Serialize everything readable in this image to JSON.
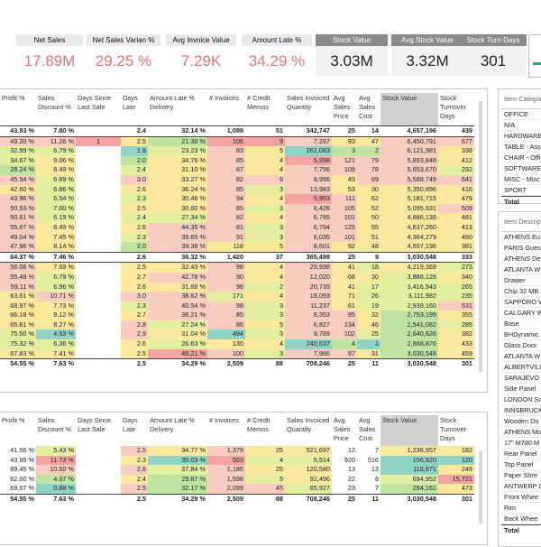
{
  "kpis": [
    {
      "label": "Net Sales",
      "value": "17.89M",
      "dark": false
    },
    {
      "label": "Net Sales Varian %",
      "value": "29.25 %",
      "dark": false
    },
    {
      "label": "Avg Invoice Value",
      "value": "7.29K",
      "dark": false
    },
    {
      "label": "Amount Late %",
      "value": "34.29 %",
      "dark": false
    },
    {
      "label": "Stock Value",
      "value": "3.03M",
      "dark": true
    },
    {
      "label": "Avg Stock Value",
      "value": "3.32M",
      "dark": true
    },
    {
      "label": "Stock Turn Days",
      "value": "301",
      "dark": true
    }
  ],
  "table1": {
    "headers": [
      "Profit %",
      "Sales Discount %",
      "Days Since Last Sale",
      "Days Late",
      "Amount Late % Delivery",
      "# Invoices",
      "# Credit Memos",
      "Sales Invoiced Quantity",
      "Avg Sales Price",
      "Avg Sales Cost",
      "Stock Value",
      "Stock Turnover Days"
    ],
    "rows": [
      {
        "type": "tot",
        "cells": [
          "43.93 %",
          "7.80 %",
          "",
          "2.4",
          "32.14 %",
          "1,089",
          "51",
          "342,747",
          "25",
          "14",
          "4,657,196",
          "439"
        ]
      },
      {
        "type": "row",
        "cells": [
          "49.20 %",
          "11.26 %",
          "1",
          "2.5",
          "21.30 %",
          "106",
          "9",
          "7,297",
          "93",
          "47",
          "6,450,791",
          "677"
        ],
        "colors": [
          "c1",
          "c1",
          "c0",
          "c2",
          "c4",
          "c0",
          "c0",
          "c1",
          "c2",
          "c2",
          "c1",
          "c1"
        ]
      },
      {
        "type": "row",
        "cells": [
          "32.99 %",
          "6.79 %",
          "",
          "1.8",
          "23.23 %",
          "83",
          "5",
          "261,063",
          "3",
          "2",
          "6,121,981",
          "338"
        ],
        "colors": [
          "c3",
          "c3",
          "",
          "c5",
          "c3",
          "c1",
          "c2",
          "c5",
          "c4",
          "c4",
          "c1",
          "c2"
        ]
      },
      {
        "type": "row",
        "cells": [
          "34.67 %",
          "9.06 %",
          "",
          "2.0",
          "34.76 %",
          "85",
          "4",
          "5,998",
          "121",
          "79",
          "5,893,848",
          "412"
        ],
        "colors": [
          "c3",
          "c2",
          "",
          "c4",
          "c2",
          "c1",
          "c2",
          "c0",
          "c1",
          "c1",
          "c1",
          "c2"
        ]
      },
      {
        "type": "row",
        "cells": [
          "28.24 %",
          "8.49 %",
          "",
          "2.4",
          "31.10 %",
          "87",
          "4",
          "7,756",
          "109",
          "78",
          "5,653,670",
          "292"
        ],
        "colors": [
          "c4",
          "c2",
          "",
          "c3",
          "c2",
          "c1",
          "c2",
          "c1",
          "c1",
          "c1",
          "c1",
          "c3"
        ]
      },
      {
        "type": "row",
        "cells": [
          "45.54 %",
          "6.69 %",
          "",
          "3.0",
          "33.27 %",
          "82",
          "6",
          "8,996",
          "49",
          "69",
          "5,588,749",
          "641"
        ],
        "colors": [
          "c1",
          "c3",
          "",
          "c1",
          "c2",
          "c1",
          "c1",
          "c1",
          "c2",
          "c1",
          "c1",
          "c1"
        ]
      },
      {
        "type": "row",
        "cells": [
          "42.60 %",
          "6.86 %",
          "",
          "2.6",
          "36.24 %",
          "95",
          "3",
          "13,983",
          "53",
          "30",
          "5,350,896",
          "416"
        ],
        "colors": [
          "c2",
          "c3",
          "",
          "c2",
          "c2",
          "c1",
          "c3",
          "c1",
          "c2",
          "c2",
          "c2",
          "c2"
        ]
      },
      {
        "type": "row",
        "cells": [
          "43.96 %",
          "6.54 %",
          "",
          "2.3",
          "30.46 %",
          "94",
          "4",
          "5,953",
          "111",
          "62",
          "5,181,715",
          "479"
        ],
        "colors": [
          "c1",
          "c3",
          "",
          "c3",
          "c2",
          "c1",
          "c2",
          "c0",
          "c1",
          "c2",
          "c2",
          "c2"
        ]
      },
      {
        "type": "row",
        "cells": [
          "50.53 %",
          "7.00 %",
          "",
          "2.5",
          "30.80 %",
          "85",
          "3",
          "6,426",
          "105",
          "52",
          "5,095,631",
          "509"
        ],
        "colors": [
          "c1",
          "c3",
          "",
          "c2",
          "c2",
          "c1",
          "c3",
          "c1",
          "c1",
          "c2",
          "c2",
          "c1"
        ]
      },
      {
        "type": "row",
        "cells": [
          "50.61 %",
          "6.19 %",
          "",
          "2.4",
          "27.34 %",
          "82",
          "4",
          "6,785",
          "101",
          "50",
          "4,886,138",
          "481"
        ],
        "colors": [
          "c1",
          "c3",
          "",
          "c3",
          "c3",
          "c1",
          "c2",
          "c1",
          "c1",
          "c2",
          "c2",
          "c2"
        ]
      },
      {
        "type": "row",
        "cells": [
          "55.67 %",
          "8.49 %",
          "",
          "2.6",
          "44.35 %",
          "81",
          "3",
          "6,794",
          "125",
          "55",
          "4,637,260",
          "413"
        ],
        "colors": [
          "c1",
          "c2",
          "",
          "c2",
          "c1",
          "c1",
          "c3",
          "c1",
          "c1",
          "c2",
          "c2",
          "c2"
        ]
      },
      {
        "type": "row",
        "cells": [
          "49.04 %",
          "7.45 %",
          "",
          "2.3",
          "39.65 %",
          "91",
          "3",
          "6,035",
          "101",
          "51",
          "4,364,279",
          "480"
        ],
        "colors": [
          "c1",
          "c2",
          "",
          "c3",
          "c1",
          "c1",
          "c3",
          "c1",
          "c1",
          "c2",
          "c2",
          "c2"
        ]
      },
      {
        "type": "row",
        "cells": [
          "47.96 %",
          "8.14 %",
          "",
          "2.0",
          "39.38 %",
          "118",
          "5",
          "8,601",
          "92",
          "48",
          "4,657,196",
          "381"
        ],
        "colors": [
          "c1",
          "c2",
          "",
          "c4",
          "c1",
          "c2",
          "c2",
          "c1",
          "c2",
          "c2",
          "c2",
          "c2"
        ]
      },
      {
        "type": "tot",
        "cells": [
          "64.37 %",
          "7.46 %",
          "",
          "2.6",
          "36.32 %",
          "1,420",
          "37",
          "365,499",
          "25",
          "9",
          "3,030,548",
          "333"
        ]
      },
      {
        "type": "row",
        "cells": [
          "56.06 %",
          "7.69 %",
          "",
          "2.5",
          "32.43 %",
          "98",
          "4",
          "29,938",
          "41",
          "18",
          "4,219,369",
          "273"
        ],
        "colors": [
          "c1",
          "c2",
          "",
          "c2",
          "c2",
          "c1",
          "c2",
          "c1",
          "c2",
          "c3",
          "c2",
          "c3"
        ]
      },
      {
        "type": "row",
        "cells": [
          "55.49 %",
          "6.79 %",
          "",
          "2.7",
          "42.78 %",
          "90",
          "4",
          "12,020",
          "68",
          "30",
          "3,886,128",
          "340"
        ],
        "colors": [
          "c1",
          "c3",
          "",
          "c2",
          "c1",
          "c1",
          "c2",
          "c1",
          "c2",
          "c2",
          "c3",
          "c2"
        ]
      },
      {
        "type": "row",
        "cells": [
          "59.11 %",
          "6.96 %",
          "",
          "2.6",
          "31.88 %",
          "96",
          "2",
          "20,739",
          "41",
          "17",
          "3,416,943",
          "265"
        ],
        "colors": [
          "c1",
          "c3",
          "",
          "c2",
          "c2",
          "c1",
          "c3",
          "c1",
          "c2",
          "c3",
          "c3",
          "c3"
        ]
      },
      {
        "type": "row",
        "cells": [
          "63.61 %",
          "10.71 %",
          "",
          "3.0",
          "38.62 %",
          "171",
          "4",
          "18,093",
          "71",
          "26",
          "3,111,982",
          "235"
        ],
        "colors": [
          "c2",
          "c1",
          "",
          "c1",
          "c1",
          "c3",
          "c2",
          "c1",
          "c2",
          "c3",
          "c3",
          "c3"
        ]
      },
      {
        "type": "row",
        "cells": [
          "68.97 %",
          "7.73 %",
          "",
          "2.3",
          "40.54 %",
          "98",
          "3",
          "11,237",
          "61",
          "19",
          "2,939,160",
          "531"
        ],
        "colors": [
          "c2",
          "c2",
          "",
          "c3",
          "c1",
          "c1",
          "c3",
          "c1",
          "c2",
          "c3",
          "c3",
          "c1"
        ]
      },
      {
        "type": "row",
        "cells": [
          "66.18 %",
          "9.12 %",
          "",
          "2.7",
          "38.21 %",
          "85",
          "3",
          "8,353",
          "95",
          "32",
          "2,753,199",
          "355"
        ],
        "colors": [
          "c2",
          "c2",
          "",
          "c2",
          "c1",
          "c1",
          "c3",
          "c1",
          "c1",
          "c2",
          "c4",
          "c2"
        ]
      },
      {
        "type": "row",
        "cells": [
          "65.61 %",
          "8.27 %",
          "",
          "2.8",
          "27.24 %",
          "86",
          "5",
          "6,827",
          "134",
          "46",
          "2,541,082",
          "285"
        ],
        "colors": [
          "c2",
          "c2",
          "",
          "c1",
          "c3",
          "c1",
          "c2",
          "c1",
          "c1",
          "c2",
          "c4",
          "c3"
        ]
      },
      {
        "type": "row",
        "cells": [
          "75.50 %",
          "4.53 %",
          "",
          "2.9",
          "31.04 %",
          "494",
          "3",
          "9,789",
          "102",
          "25",
          "2,640,626",
          "382"
        ],
        "colors": [
          "c3",
          "c5",
          "",
          "c1",
          "c2",
          "c5",
          "c3",
          "c1",
          "c1",
          "c3",
          "c4",
          "c2"
        ]
      },
      {
        "type": "row",
        "cells": [
          "75.32 %",
          "6.36 %",
          "",
          "2.6",
          "26.63 %",
          "130",
          "4",
          "240,537",
          "4",
          "1",
          "2,868,876",
          "433"
        ],
        "colors": [
          "c3",
          "c3",
          "",
          "c2",
          "c3",
          "c2",
          "c2",
          "c5",
          "c4",
          "c5",
          "c4",
          "c2"
        ]
      },
      {
        "type": "row",
        "cells": [
          "67.83 %",
          "7.41 %",
          "",
          "2.5",
          "46.21 %",
          "100",
          "3",
          "7,966",
          "97",
          "31",
          "3,030,548",
          "459"
        ],
        "colors": [
          "c2",
          "c2",
          "",
          "c2",
          "c0",
          "c1",
          "c3",
          "c1",
          "c1",
          "c2",
          "c4",
          "c2"
        ]
      },
      {
        "type": "foot",
        "cells": [
          "54.55 %",
          "7.63 %",
          "",
          "2.5",
          "34.29 %",
          "2,509",
          "88",
          "708,246",
          "25",
          "11",
          "3,030,548",
          "301"
        ]
      }
    ]
  },
  "table2": {
    "headers": [
      "Profit %",
      "Sales Discount %",
      "Days Since Last Sale",
      "Days Late",
      "Amount Late % Delivery",
      "# Invoices",
      "# Credit Memos",
      "Sales Invoiced Quantity",
      "Avg Sales Price",
      "Avg Sales Cost",
      "Stock Value",
      "Stock Turnover Days"
    ],
    "rows": [
      {
        "type": "row",
        "cells": [
          "41.56 %",
          "5.43 %",
          "",
          "2.5",
          "34.77 %",
          "1,379",
          "25",
          "521,697",
          "12",
          "7",
          "1,236,957",
          "182"
        ],
        "colors": [
          "",
          "c3",
          "",
          "c1",
          "c2",
          "c1",
          "c2",
          "c2",
          "",
          "",
          "c2",
          "c2"
        ]
      },
      {
        "type": "row",
        "cells": [
          "43.99 %",
          "11.73 %",
          "",
          "2.3",
          "35.03 %",
          "553",
          "4",
          "5,514",
          "920",
          "516",
          "156,920",
          "120"
        ],
        "colors": [
          "",
          "c0",
          "",
          "c2",
          "c5",
          "c0",
          "c3",
          "c3",
          "",
          "",
          "c5",
          "c5"
        ]
      },
      {
        "type": "row",
        "cells": [
          "89.45 %",
          "10.50 %",
          "",
          "2.6",
          "37.84 %",
          "1,186",
          "25",
          "120,580",
          "13",
          "13",
          "116,671",
          "249"
        ],
        "colors": [
          "",
          "c1",
          "",
          "c1",
          "c3",
          "c1",
          "c2",
          "c2",
          "",
          "",
          "c5",
          "c2"
        ]
      },
      {
        "type": "row",
        "cells": [
          "62.00 %",
          "4.07 %",
          "",
          "2.4",
          "29.87 %",
          "1,598",
          "5",
          "92,496",
          "22",
          "8",
          "694,952",
          "15,721"
        ],
        "colors": [
          "",
          "c4",
          "",
          "c2",
          "c4",
          "c1",
          "c3",
          "c2",
          "",
          "",
          "c3",
          "c0"
        ]
      },
      {
        "type": "row",
        "cells": [
          "69.67 %",
          "0.88 %",
          "",
          "2.5",
          "32.17 %",
          "2,099",
          "45",
          "65,927",
          "23",
          "7",
          "294,161",
          "473"
        ],
        "colors": [
          "",
          "c5",
          "",
          "c1",
          "c4",
          "c1",
          "c1",
          "c3",
          "",
          "",
          "c4",
          "c2"
        ]
      },
      {
        "type": "foot",
        "cells": [
          "54.55 %",
          "7.63 %",
          "",
          "2.5",
          "34.29 %",
          "2,509",
          "88",
          "708,246",
          "25",
          "11",
          "3,030,548",
          "301"
        ]
      }
    ]
  },
  "slicer1": {
    "header": "Item Category",
    "items": [
      "OFFICE",
      "N/A",
      "HARDWARE",
      "TABLE - Ass",
      "CHAIR - Offi",
      "SOFTWARE",
      "MISC - Misc",
      "SPORT"
    ],
    "total": "Total"
  },
  "slicer2": {
    "header": "Item Description",
    "items": [
      "ATHENS Eu",
      "PARIS Gues",
      "ATHENS De",
      "ATLANTA W",
      "Drawer",
      "Chip 32 MB",
      "SAPPORO W",
      "CALGARY W",
      "Base",
      "BHDynamic",
      "Glass Door",
      "ATLANTA W",
      "ALBERTVILL",
      "SARAJEVO",
      "Side Panel",
      "LONDON Sw",
      "INNSBRUCK",
      "Wooden Do",
      "ATHENS Mo",
      "17\" M780 M",
      "Rear Panel",
      "Top Panel",
      "Paper Shre",
      "ANTWERP C",
      "Front Whee",
      "Rim",
      "Back Whee"
    ],
    "total": "Total"
  }
}
